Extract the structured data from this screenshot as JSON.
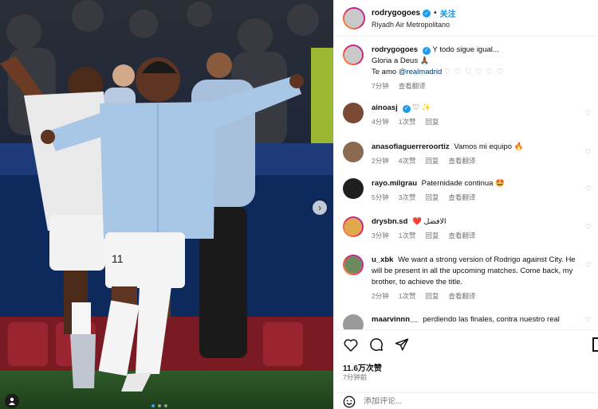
{
  "colors": {
    "accent": "#0095f6",
    "verified": "#1d9bf0",
    "muted": "#737373"
  },
  "header": {
    "username": "rodrygogoes",
    "separator": "•",
    "follow_label": "关注",
    "location": "Riyadh Air Metropolitano"
  },
  "caption": {
    "username": "rodrygogoes",
    "line1": "Y todo sigue igual...",
    "line2": "Gloria a Deus 🙏🏾",
    "line3_prefix": "Te amo",
    "mention": "@realmadrid",
    "hearts": "♡ ♡ ♡ ♡ ♡ ♡",
    "time": "7分钟",
    "translate": "查看翻译"
  },
  "comments": [
    {
      "username": "ainoasj",
      "text": "♡ ✨",
      "time": "4分钟",
      "likes": "1次赞",
      "reply": "回复",
      "translate": ""
    },
    {
      "username": "anasofiaguerreroortiz",
      "text": "Vamos mi equipo 🔥",
      "time": "2分钟",
      "likes": "4次赞",
      "reply": "回复",
      "translate": "查看翻译"
    },
    {
      "username": "rayo.milgrau",
      "text": "Paternidade continua 🤩",
      "time": "5分钟",
      "likes": "3次赞",
      "reply": "回复",
      "translate": "查看翻译"
    },
    {
      "username": "drysbn.sd",
      "text": "❤️ الافضل",
      "time": "3分钟",
      "likes": "1次赞",
      "reply": "回复",
      "translate": "查看翻译"
    },
    {
      "username": "u_xbk",
      "text": "We want a strong version of Rodrigo against City. He will be present in all the upcoming matches. Come back, my brother, to achieve the title.",
      "time": "2分钟",
      "likes": "1次赞",
      "reply": "回复",
      "translate": "查看翻译"
    },
    {
      "username": "maarvinnn__",
      "text": "perdiendo las finales, contra nuestro real",
      "time": "",
      "likes": "",
      "reply": "",
      "translate": ""
    }
  ],
  "actions": {
    "like_icon": "heart-icon",
    "comment_icon": "comment-icon",
    "share_icon": "send-icon",
    "save_icon": "bookmark-icon",
    "likes_count": "11.6万次赞",
    "posted_ago": "7分钟前"
  },
  "add_comment": {
    "placeholder": "添加评论..."
  },
  "photo": {
    "jersey_number": "11"
  }
}
